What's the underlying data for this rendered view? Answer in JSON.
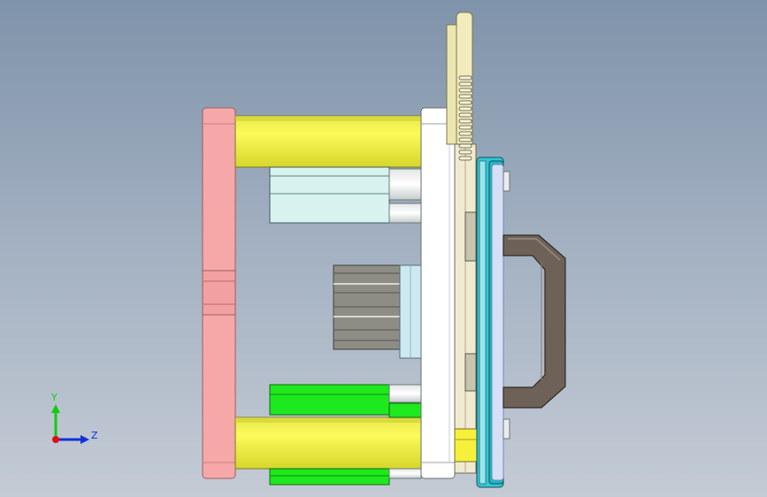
{
  "viewport": {
    "background_top": "#7f93aa",
    "background_bottom": "#c4cbd5"
  },
  "model": {
    "parts": [
      {
        "name": "rear-clamp-plate",
        "color": "#f6a8a8"
      },
      {
        "name": "guide-pillar",
        "color": "#f0f043"
      },
      {
        "name": "core-insert-light-cyan",
        "color": "#d8f3ef"
      },
      {
        "name": "core-insert-green",
        "color": "#1ee81e"
      },
      {
        "name": "ejector-block-gray",
        "color": "#8d8d86"
      },
      {
        "name": "moving-plate",
        "color": "#ffffff"
      },
      {
        "name": "cooling-plate-beige",
        "color": "#ece6b0"
      },
      {
        "name": "fixed-plate-cyan",
        "color": "#2ec8d6"
      },
      {
        "name": "handle",
        "color": "#6e6258"
      }
    ]
  },
  "triad": {
    "y_label": "Y",
    "z_label": "Z",
    "y_color": "#11cc11",
    "z_color": "#1030dd",
    "origin_color": "#e01010"
  }
}
